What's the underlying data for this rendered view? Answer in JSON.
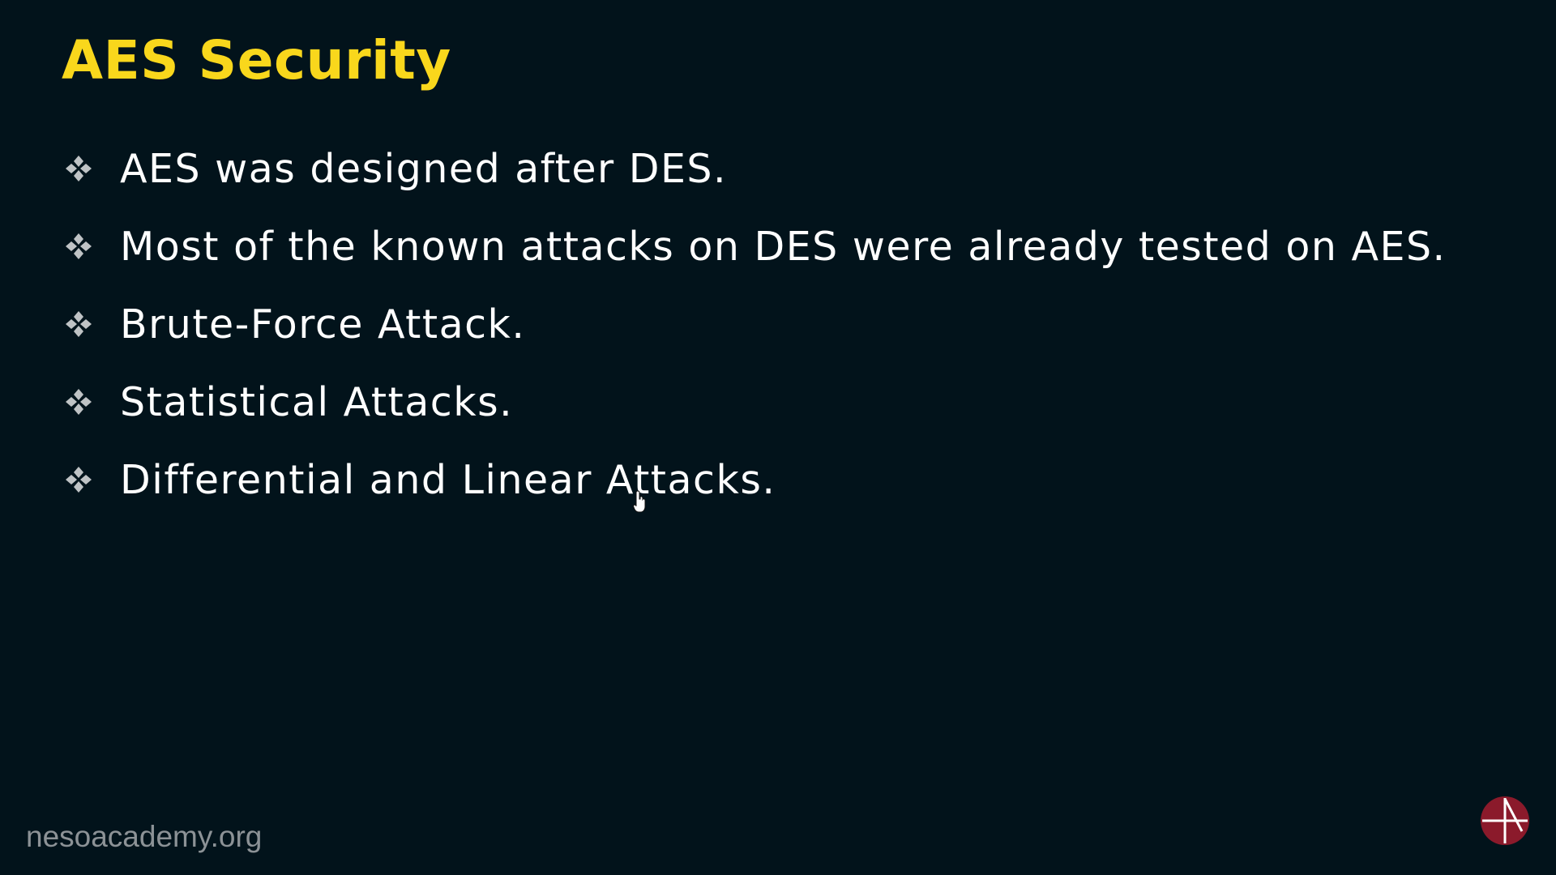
{
  "slide": {
    "title": "AES Security",
    "title_color": "#f9d71c",
    "background_color": "#02131b",
    "bullet_icon": "four-diamond-icon",
    "bullets": [
      "AES was designed after DES.",
      "Most of the known attacks on DES were already tested on AES.",
      "Brute-Force Attack.",
      "Statistical Attacks.",
      "Differential and Linear Attacks."
    ]
  },
  "footer": {
    "website": "nesoacademy.org"
  },
  "logo": {
    "icon": "neso-academy-logo",
    "color": "#8b1a2b"
  },
  "cursor": {
    "icon": "hand-pointer-icon"
  }
}
